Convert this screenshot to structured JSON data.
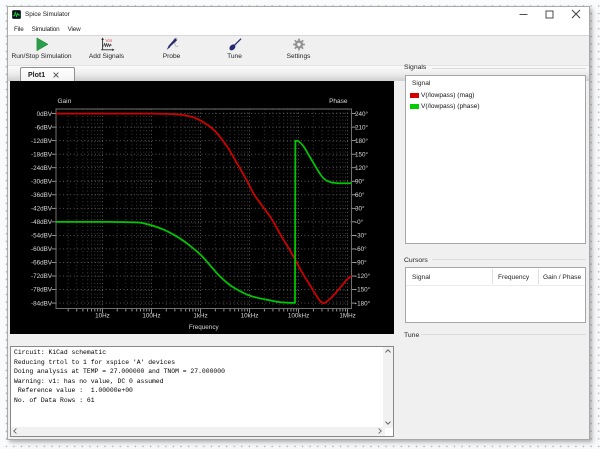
{
  "window": {
    "title": "Spice Simulator"
  },
  "titlebar": {
    "buttons": [
      "minimize-icon",
      "maximize-icon",
      "close-icon"
    ]
  },
  "menu": {
    "items": [
      {
        "label": "File"
      },
      {
        "label": "Simulation"
      },
      {
        "label": "View"
      }
    ]
  },
  "toolbar": {
    "items": [
      {
        "label": "Run/Stop Simulation",
        "icon": "run-simulation-icon"
      },
      {
        "label": "Add Signals",
        "icon": "add-signals-icon"
      },
      {
        "label": "Probe",
        "icon": "probe-icon"
      },
      {
        "label": "Tune",
        "icon": "tune-icon"
      },
      {
        "label": "Settings",
        "icon": "settings-gear-icon"
      }
    ]
  },
  "tabs": [
    {
      "label": "Plot1"
    }
  ],
  "signals_panel": {
    "title": "Signals",
    "column_header": "Signal",
    "rows": [
      {
        "label": "V(/lowpass) (mag)",
        "color": "#d40000"
      },
      {
        "label": "V(/lowpass) (phase)",
        "color": "#00cc00"
      }
    ]
  },
  "cursors_panel": {
    "title": "Cursors",
    "headers": [
      "Signal",
      "Frequency",
      "Gain / Phase"
    ]
  },
  "tune_panel": {
    "title": "Tune"
  },
  "console": {
    "lines": [
      "Circuit: KiCad schematic",
      "Reducing trtol to 1 for xspice 'A' devices",
      "Doing analysis at TEMP = 27.000000 and TNOM = 27.000000",
      "Warning: v1: has no value, DC 0 assumed",
      " Reference value :  1.00000e+00",
      "No. of Data Rows : 61"
    ]
  },
  "chart_data": {
    "type": "line",
    "x_axis": {
      "label": "Frequency",
      "scale": "log",
      "ticks": [
        "10Hz",
        "100Hz",
        "1kHz",
        "10kHz",
        "100kHz",
        "1MHz"
      ],
      "tick_values": [
        10,
        100,
        1000,
        10000,
        100000,
        1000000
      ],
      "minor_log_steps": [
        2,
        3,
        4,
        5,
        6,
        7,
        8,
        9
      ],
      "range": [
        1.13,
        1200000
      ]
    },
    "y_axis_left": {
      "label": "Gain",
      "unit": "dBV",
      "ticks": [
        "0dBV",
        "-6dBV",
        "-12dBV",
        "-18dBV",
        "-24dBV",
        "-30dBV",
        "-36dBV",
        "-42dBV",
        "-48dBV",
        "-54dBV",
        "-60dBV",
        "-66dBV",
        "-72dBV",
        "-78dBV",
        "-84dBV"
      ],
      "tick_values": [
        0,
        -6,
        -12,
        -18,
        -24,
        -30,
        -36,
        -42,
        -48,
        -54,
        -60,
        -66,
        -72,
        -78,
        -84
      ],
      "range": [
        2.03,
        -86.4
      ]
    },
    "y_axis_right": {
      "label": "Phase",
      "unit": "deg",
      "ticks": [
        "240°",
        "210°",
        "180°",
        "150°",
        "120°",
        "90°",
        "60°",
        "30°",
        "-0°",
        "-30°",
        "-60°",
        "-90°",
        "-120°",
        "-150°",
        "-180°"
      ],
      "tick_values": [
        240,
        210,
        180,
        150,
        120,
        90,
        60,
        30,
        0,
        -30,
        -60,
        -90,
        -120,
        -150,
        -180
      ],
      "range": [
        250.0,
        -192.1
      ]
    },
    "grid": true,
    "background": "#000000",
    "series": [
      {
        "name": "V(/lowpass) (mag)",
        "axis": "left",
        "color": "#d10000",
        "points": [
          [
            1.13,
            0
          ],
          [
            5,
            0
          ],
          [
            20,
            0
          ],
          [
            60,
            0
          ],
          [
            120,
            -0.05
          ],
          [
            200,
            -0.12
          ],
          [
            300,
            -0.3
          ],
          [
            420,
            -0.55
          ],
          [
            550,
            -1.0
          ],
          [
            700,
            -1.6
          ],
          [
            850,
            -2.3
          ],
          [
            1000,
            -3.1
          ],
          [
            1250,
            -4.4
          ],
          [
            1500,
            -5.5
          ],
          [
            2000,
            -7.9
          ],
          [
            2700,
            -11.3
          ],
          [
            3700,
            -15.5
          ],
          [
            5000,
            -20.3
          ],
          [
            7000,
            -25.8
          ],
          [
            9200,
            -30.5
          ],
          [
            12500,
            -36.0
          ],
          [
            17600,
            -40.5
          ],
          [
            28000,
            -46.6
          ],
          [
            45000,
            -54.5
          ],
          [
            72000,
            -61.8
          ],
          [
            115000,
            -70.0
          ],
          [
            185000,
            -77.3
          ],
          [
            264000,
            -82.6
          ],
          [
            330000,
            -84.0
          ],
          [
            475000,
            -81.4
          ],
          [
            675000,
            -77.6
          ],
          [
            960000,
            -73.7
          ],
          [
            1200000,
            -72.0
          ]
        ]
      },
      {
        "name": "V(/lowpass) (phase)",
        "axis": "right",
        "color": "#00c800",
        "points": [
          [
            1.13,
            -0.1
          ],
          [
            10,
            -0.2
          ],
          [
            30,
            -0.8
          ],
          [
            60,
            -2.0
          ],
          [
            115,
            -9.8
          ],
          [
            178,
            -17.5
          ],
          [
            276,
            -27.8
          ],
          [
            428,
            -40.6
          ],
          [
            662,
            -56.1
          ],
          [
            1030,
            -74.2
          ],
          [
            1600,
            -97.5
          ],
          [
            2480,
            -120.7
          ],
          [
            3830,
            -138.7
          ],
          [
            5930,
            -151.7
          ],
          [
            9200,
            -162.0
          ],
          [
            14200,
            -168.2
          ],
          [
            22000,
            -172.4
          ],
          [
            34000,
            -176.5
          ],
          [
            45000,
            -178.5
          ],
          [
            60000,
            -179.3
          ],
          [
            84500,
            -179.8
          ],
          [
            86000,
            179.8
          ],
          [
            95000,
            179.0
          ],
          [
            101500,
            178.0
          ],
          [
            128000,
            166.4
          ],
          [
            161000,
            148.0
          ],
          [
            203000,
            129.6
          ],
          [
            257000,
            111.0
          ],
          [
            324000,
            96.3
          ],
          [
            444000,
            88.0
          ],
          [
            604000,
            85.8
          ],
          [
            800000,
            85.4
          ],
          [
            1000000,
            85.4
          ],
          [
            1200000,
            85.5
          ]
        ]
      }
    ]
  }
}
